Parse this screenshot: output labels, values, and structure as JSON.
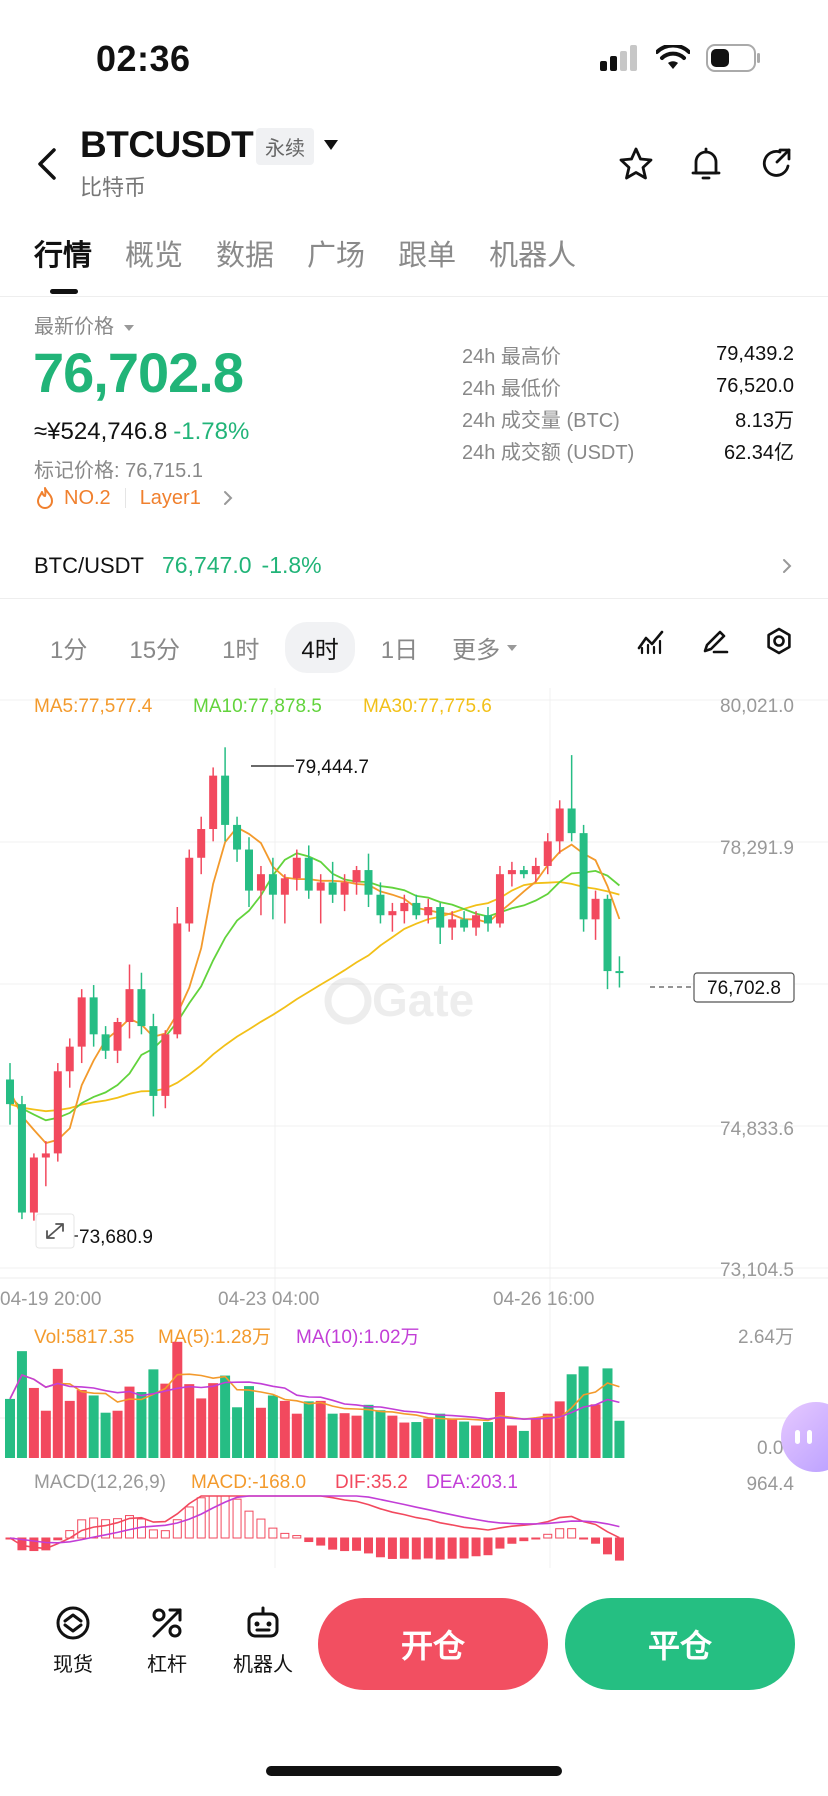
{
  "status": {
    "time": "02:36"
  },
  "header": {
    "pair": "BTCUSDT",
    "contract_type": "永续",
    "subname": "比特币"
  },
  "tabs": [
    "行情",
    "概览",
    "数据",
    "广场",
    "跟单",
    "机器人"
  ],
  "ticker": {
    "latest_label": "最新价格",
    "price": "76,702.8",
    "cny_price": "≈¥524,746.8",
    "change_pct": "-1.78%",
    "mark_price": "标记价格: 76,715.1",
    "rank": "NO.2",
    "tag": "Layer1",
    "stats": [
      {
        "k": "24h 最高价",
        "v": "79,439.2"
      },
      {
        "k": "24h 最低价",
        "v": "76,520.0"
      },
      {
        "k": "24h 成交量 (BTC)",
        "v": "8.13万"
      },
      {
        "k": "24h 成交额 (USDT)",
        "v": "62.34亿"
      }
    ]
  },
  "spot": {
    "symbol": "BTC/USDT",
    "price": "76,747.0",
    "change": "-1.8%"
  },
  "intervals": {
    "items": [
      "1分",
      "15分",
      "1时",
      "4时",
      "1日"
    ],
    "active": 3,
    "more": "更多"
  },
  "chart_data": {
    "type": "candlestick",
    "ma_legend": {
      "ma5": "MA5:77,577.4",
      "ma10": "MA10:77,878.5",
      "ma30": "MA30:77,775.6"
    },
    "y_ticks": [
      "80,021.0",
      "78,291.9",
      "74,833.6",
      "73,104.5"
    ],
    "ylim": [
      73104.5,
      80021.0
    ],
    "x_ticks": [
      "04-19 20:00",
      "04-23 04:00",
      "04-26 16:00"
    ],
    "high_marker": "79,444.7",
    "low_marker": "73,680.9",
    "last_price_label": "76,702.8",
    "colors": {
      "up": "#f2495e",
      "down": "#26bd84",
      "ma5": "#f39a2c",
      "ma10": "#62d33c",
      "ma30": "#f2c018",
      "macd_dif": "#f2495e",
      "macd_dea": "#c23ed7"
    },
    "candles": [
      {
        "o": 75400,
        "h": 75600,
        "l": 74850,
        "c": 75100
      },
      {
        "o": 75100,
        "h": 75200,
        "l": 73700,
        "c": 73780
      },
      {
        "o": 73780,
        "h": 74500,
        "l": 73681,
        "c": 74450
      },
      {
        "o": 74450,
        "h": 74650,
        "l": 74100,
        "c": 74500
      },
      {
        "o": 74500,
        "h": 75600,
        "l": 74400,
        "c": 75500
      },
      {
        "o": 75500,
        "h": 75900,
        "l": 75300,
        "c": 75800
      },
      {
        "o": 75800,
        "h": 76500,
        "l": 75600,
        "c": 76400
      },
      {
        "o": 76400,
        "h": 76550,
        "l": 75800,
        "c": 75950
      },
      {
        "o": 75950,
        "h": 76050,
        "l": 75650,
        "c": 75750
      },
      {
        "o": 75750,
        "h": 76150,
        "l": 75600,
        "c": 76100
      },
      {
        "o": 76100,
        "h": 76800,
        "l": 75900,
        "c": 76500
      },
      {
        "o": 76500,
        "h": 76700,
        "l": 75950,
        "c": 76050
      },
      {
        "o": 76050,
        "h": 76200,
        "l": 74950,
        "c": 75200
      },
      {
        "o": 75200,
        "h": 76000,
        "l": 75050,
        "c": 75950
      },
      {
        "o": 75950,
        "h": 77500,
        "l": 75900,
        "c": 77300
      },
      {
        "o": 77300,
        "h": 78200,
        "l": 77200,
        "c": 78100
      },
      {
        "o": 78100,
        "h": 78600,
        "l": 77900,
        "c": 78450
      },
      {
        "o": 78450,
        "h": 79200,
        "l": 78300,
        "c": 79100
      },
      {
        "o": 79100,
        "h": 79445,
        "l": 78300,
        "c": 78500
      },
      {
        "o": 78500,
        "h": 78600,
        "l": 78050,
        "c": 78200
      },
      {
        "o": 78200,
        "h": 78350,
        "l": 77500,
        "c": 77700
      },
      {
        "o": 77700,
        "h": 78000,
        "l": 77400,
        "c": 77900
      },
      {
        "o": 77900,
        "h": 78100,
        "l": 77350,
        "c": 77650
      },
      {
        "o": 77650,
        "h": 77900,
        "l": 77300,
        "c": 77850
      },
      {
        "o": 77850,
        "h": 78200,
        "l": 77700,
        "c": 78100
      },
      {
        "o": 78100,
        "h": 78250,
        "l": 77600,
        "c": 77700
      },
      {
        "o": 77700,
        "h": 77900,
        "l": 77300,
        "c": 77800
      },
      {
        "o": 77800,
        "h": 78050,
        "l": 77550,
        "c": 77650
      },
      {
        "o": 77650,
        "h": 77900,
        "l": 77450,
        "c": 77800
      },
      {
        "o": 77800,
        "h": 78000,
        "l": 77650,
        "c": 77950
      },
      {
        "o": 77950,
        "h": 78150,
        "l": 77500,
        "c": 77650
      },
      {
        "o": 77650,
        "h": 77800,
        "l": 77300,
        "c": 77400
      },
      {
        "o": 77400,
        "h": 77550,
        "l": 77200,
        "c": 77450
      },
      {
        "o": 77450,
        "h": 77650,
        "l": 77300,
        "c": 77550
      },
      {
        "o": 77550,
        "h": 77650,
        "l": 77350,
        "c": 77400
      },
      {
        "o": 77400,
        "h": 77600,
        "l": 77300,
        "c": 77500
      },
      {
        "o": 77500,
        "h": 77550,
        "l": 77050,
        "c": 77250
      },
      {
        "o": 77250,
        "h": 77450,
        "l": 77100,
        "c": 77350
      },
      {
        "o": 77350,
        "h": 77450,
        "l": 77200,
        "c": 77250
      },
      {
        "o": 77250,
        "h": 77450,
        "l": 77150,
        "c": 77400
      },
      {
        "o": 77400,
        "h": 77500,
        "l": 77200,
        "c": 77300
      },
      {
        "o": 77300,
        "h": 78000,
        "l": 77250,
        "c": 77900
      },
      {
        "o": 77900,
        "h": 78050,
        "l": 77750,
        "c": 77950
      },
      {
        "o": 77950,
        "h": 78000,
        "l": 77850,
        "c": 77900
      },
      {
        "o": 77900,
        "h": 78100,
        "l": 77800,
        "c": 78000
      },
      {
        "o": 78000,
        "h": 78400,
        "l": 77900,
        "c": 78300
      },
      {
        "o": 78300,
        "h": 78800,
        "l": 78150,
        "c": 78700
      },
      {
        "o": 78700,
        "h": 79350,
        "l": 78300,
        "c": 78400
      },
      {
        "o": 78400,
        "h": 78500,
        "l": 77200,
        "c": 77350
      },
      {
        "o": 77350,
        "h": 77700,
        "l": 77100,
        "c": 77600
      },
      {
        "o": 77600,
        "h": 77650,
        "l": 76500,
        "c": 76720
      },
      {
        "o": 76720,
        "h": 76900,
        "l": 76520,
        "c": 76703
      }
    ],
    "volume": {
      "legend": {
        "vol": "Vol:5817.35",
        "ma5": "MA(5):1.28万",
        "ma10": "MA(10):1.02万"
      },
      "y_max_label": "2.64万",
      "y_zero_label": "0.00",
      "y_max": 26400
    },
    "macd": {
      "legend": {
        "params": "MACD(12,26,9)",
        "macd": "MACD:-168.0",
        "dif": "DIF:35.2",
        "dea": "DEA:203.1"
      },
      "y_max_label": "964.4"
    }
  },
  "bottom_bar": {
    "spot": "现货",
    "leverage": "杠杆",
    "bot": "机器人",
    "open": "开仓",
    "close": "平仓"
  },
  "watermark": "Gate"
}
